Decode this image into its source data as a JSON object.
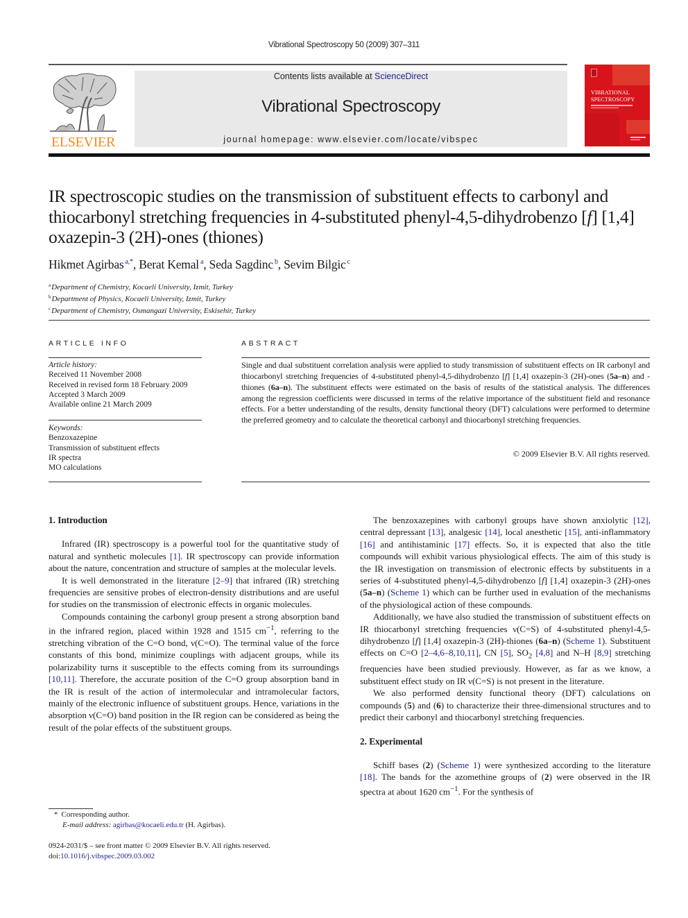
{
  "running_head": "Vibrational Spectroscopy 50 (2009) 307–311",
  "masthead": {
    "publisher_logo_text": "ELSEVIER",
    "contents_prefix": "Contents lists available at ",
    "contents_link": "ScienceDirect",
    "journal_title": "Vibrational Spectroscopy",
    "homepage": "journal homepage: www.elsevier.com/locate/vibspec",
    "cover_title_line1": "VIBRATIONAL",
    "cover_title_line2": "SPECTROSCOPY",
    "colors": {
      "logo_orange": "#f28a1e",
      "cover_red": "#d7141c",
      "box_gray": "#e9e9e9",
      "link_blue": "#23238e"
    }
  },
  "article": {
    "title": "IR spectroscopic studies on the transmission of substituent effects to carbonyl and thiocarbonyl stretching frequencies in 4-substituted phenyl-4,5-dihydrobenzo [f] [1,4] oxazepin-3 (2H)-ones (thiones)",
    "title_parts": {
      "a": "IR spectroscopic studies on the transmission of substituent effects to carbonyl and thiocarbonyl stretching frequencies in 4-substituted phenyl-4,5-dihydrobenzo [",
      "f": "f",
      "b": "] [1,4] oxazepin-3 (2H)-ones (thiones)"
    },
    "authors": [
      {
        "name": "Hikmet Agirbas",
        "sup": "a,*",
        "sep": ", "
      },
      {
        "name": "Berat Kemal",
        "sup": "a",
        "sep": ", "
      },
      {
        "name": "Seda Sagdinc",
        "sup": "b",
        "sep": ", "
      },
      {
        "name": "Sevim Bilgic",
        "sup": "c",
        "sep": ""
      }
    ],
    "affiliations": [
      {
        "key": "a",
        "text": "Department of Chemistry, Kocaeli University, Izmit, Turkey"
      },
      {
        "key": "b",
        "text": "Department of Physics, Kocaeli University, Izmit, Turkey"
      },
      {
        "key": "c",
        "text": "Department of Chemistry, Osmangazi University, Eskisehir, Turkey"
      }
    ]
  },
  "article_info": {
    "heading": "ARTICLE INFO",
    "history_label": "Article history:",
    "history": [
      "Received 11 November 2008",
      "Received in revised form 18 February 2009",
      "Accepted 3 March 2009",
      "Available online 21 March 2009"
    ],
    "keywords_label": "Keywords:",
    "keywords": [
      "Benzoxazepine",
      "Transmission of substituent effects",
      "IR spectra",
      "MO calculations"
    ]
  },
  "abstract": {
    "heading": "ABSTRACT",
    "t1": "Single and dual substituent correlation analysis were applied to study transmission of substituent effects on IR carbonyl and thiocarbonyl stretching frequencies of 4-substituted phenyl-4,5-dihydrobenzo [",
    "f": "f",
    "t2": "] [1,4] oxazepin-3 (2H)-ones (",
    "c1": "5a–n",
    "t3": ") and -thiones (",
    "c2": "6a–n",
    "t4": "). The substituent effects were estimated on the basis of results of the statistical analysis. The differences among the regression coefficients were discussed in terms of the relative importance of the substituent field and resonance effects. For a better understanding of the results, density functional theory (DFT) calculations were performed to determine the preferred geometry and to calculate the theoretical carbonyl and thiocarbonyl stretching frequencies.",
    "copyright": "© 2009 Elsevier B.V. All rights reserved."
  },
  "intro": {
    "heading": "1.  Introduction",
    "p1_a": "Infrared (IR) spectroscopy is a powerful tool for the quantitative study of natural and synthetic molecules ",
    "p1_ref1": "[1]",
    "p1_b": ". IR spectroscopy can provide information about the nature, concentration and structure of samples at the molecular levels.",
    "p2_a": "It is well demonstrated in the literature ",
    "p2_ref1": "[2–9]",
    "p2_b": " that infrared (IR) stretching frequencies are sensitive probes of electron-density distributions and are useful for studies on the transmission of electronic effects in organic molecules.",
    "p3_a": "Compounds containing the carbonyl group present a strong absorption band in the infrared region, placed within 1928 and 1515 cm",
    "p3_sup": "−1",
    "p3_b": ", referring to the stretching vibration of the C=O bond, ν(C=O). The terminal value of the force constants of this bond, minimize couplings with adjacent groups, while its polarizability turns it susceptible to the effects coming from its surroundings ",
    "p3_ref1": "[10,11]",
    "p3_c": ". Therefore, the accurate position of the C=O group absorption band in the IR is result of the action of intermolecular and intramolecular factors, mainly of the electronic influence of substituent groups. Hence, variations in the absorption ν(C=O) band position in the IR region can be considered as being the result of the polar effects of the substituent groups.",
    "p4_a": "The benzoxazepines with carbonyl groups have shown anxiolytic ",
    "p4_r12": "[12]",
    "p4_b": ", central depressant ",
    "p4_r13": "[13]",
    "p4_c": ", analgesic ",
    "p4_r14": "[14]",
    "p4_d": ", local anesthetic ",
    "p4_r15": "[15]",
    "p4_e": ", anti-inflammatory ",
    "p4_r16": "[16]",
    "p4_f": " and antihistaminic ",
    "p4_r17": "[17]",
    "p4_g": " effects. So, it is expected that also the title compounds will exhibit various physiological effects. The aim of this study is the IR investigation on transmission of electronic effects by substituents in a series of 4-substituted phenyl-4,5-dihydrobenzo [",
    "p4_f_it": "f",
    "p4_h": "] [1,4] oxazepin-3 (2H)-ones (",
    "p4_cmp": "5a–n",
    "p4_i": ") (",
    "p4_scheme": "Scheme 1",
    "p4_j": ") which can be further used in evaluation of the mechanisms of the physiological action of these compounds.",
    "p5_a": "Additionally, we have also studied the transmission of substituent effects on IR thiocarbonyl stretching frequencies ν(C=S) of 4-substituted phenyl-4,5-dihydrobenzo [",
    "p5_f_it": "f",
    "p5_b": "] [1,4] oxazepin-3 (2H)-thiones (",
    "p5_cmp": "6a–n",
    "p5_c": ") (",
    "p5_scheme": "Scheme 1",
    "p5_d": "). Substituent effects on C=O ",
    "p5_r1": "[2–4,6–8,10,11]",
    "p5_e": ", CN ",
    "p5_r2": "[5]",
    "p5_f": ", SO",
    "p5_sub": "2",
    "p5_g": " ",
    "p5_r3": "[4,8]",
    "p5_h": " and N–H ",
    "p5_r4": "[8,9]",
    "p5_i": " stretching frequencies have been studied previously. However, as far as we know, a substituent effect study on IR ν(C=S) is not present in the literature.",
    "p6_a": "We also performed density functional theory (DFT) calculations on compounds (",
    "p6_c1": "5",
    "p6_b": ") and (",
    "p6_c2": "6",
    "p6_c": ") to characterize their three-dimensional structures and to predict their carbonyl and thiocarbonyl stretching frequencies."
  },
  "experimental": {
    "heading": "2.  Experimental",
    "p1_a": "Schiff bases (",
    "p1_c1": "2",
    "p1_b": ") (",
    "p1_scheme": "Scheme 1",
    "p1_c": ") were synthesized according to the literature ",
    "p1_ref": "[18]",
    "p1_d": ". The bands for the azomethine groups of (",
    "p1_c2": "2",
    "p1_e": ") were observed in the IR spectra at about 1620 cm",
    "p1_sup": "−1",
    "p1_f": ". For the synthesis of"
  },
  "footnotes": {
    "star": "*",
    "corresponding": "Corresponding author.",
    "email_label": "E-mail address: ",
    "email": "agirbas@kocaeli.edu.tr",
    "email_suffix": " (H. Agirbas).",
    "front_matter": "0924-2031/$ – see front matter © 2009 Elsevier B.V. All rights reserved.",
    "doi_prefix": "doi:",
    "doi": "10.1016/j.vibspec.2009.03.002"
  }
}
